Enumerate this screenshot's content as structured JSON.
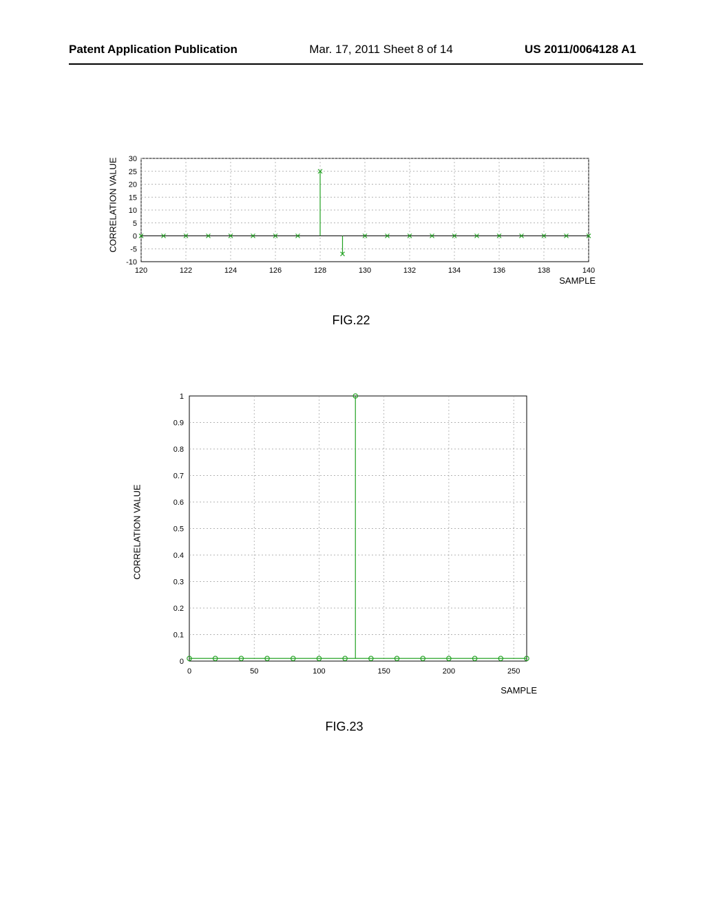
{
  "header": {
    "left": "Patent Application Publication",
    "center": "Mar. 17, 2011  Sheet 8 of 14",
    "right": "US 2011/0064128 A1"
  },
  "fig22": {
    "caption": "FIG.22",
    "ylabel": "CORRELATION VALUE",
    "xlabel": "SAMPLE",
    "yticks": [
      -10,
      -5,
      0,
      5,
      10,
      15,
      20,
      25,
      30
    ],
    "xticks": [
      120,
      122,
      124,
      126,
      128,
      130,
      132,
      134,
      136,
      138,
      140
    ],
    "xlim": [
      120,
      140
    ],
    "ylim": [
      -10,
      30
    ]
  },
  "fig23": {
    "caption": "FIG.23",
    "ylabel": "CORRELATION VALUE",
    "xlabel": "SAMPLE",
    "yticks": [
      0,
      0.1,
      0.2,
      0.3,
      0.4,
      0.5,
      0.6,
      0.7,
      0.8,
      0.9,
      1
    ],
    "xticks": [
      0,
      50,
      100,
      150,
      200,
      250
    ],
    "xlim": [
      0,
      260
    ],
    "ylim": [
      0,
      1
    ]
  },
  "chart_data": [
    {
      "type": "scatter",
      "title": "FIG.22",
      "xlabel": "SAMPLE",
      "ylabel": "CORRELATION VALUE",
      "xlim": [
        120,
        140
      ],
      "ylim": [
        -10,
        30
      ],
      "x": [
        120,
        121,
        122,
        123,
        124,
        125,
        126,
        127,
        128,
        129,
        130,
        131,
        132,
        133,
        134,
        135,
        136,
        137,
        138,
        139,
        140
      ],
      "values": [
        0,
        0,
        0,
        0,
        0,
        0,
        0,
        0,
        25,
        -7,
        0,
        0,
        0,
        0,
        0,
        0,
        0,
        0,
        0,
        0,
        0
      ]
    },
    {
      "type": "scatter",
      "title": "FIG.23",
      "xlabel": "SAMPLE",
      "ylabel": "CORRELATION VALUE",
      "xlim": [
        0,
        260
      ],
      "ylim": [
        0,
        1
      ],
      "x": [
        0,
        20,
        40,
        60,
        80,
        100,
        120,
        128,
        140,
        160,
        180,
        200,
        220,
        240,
        260
      ],
      "values": [
        0.01,
        0.01,
        0.01,
        0.01,
        0.01,
        0.01,
        0.01,
        1.0,
        0.01,
        0.01,
        0.01,
        0.01,
        0.01,
        0.01,
        0.01
      ]
    }
  ]
}
